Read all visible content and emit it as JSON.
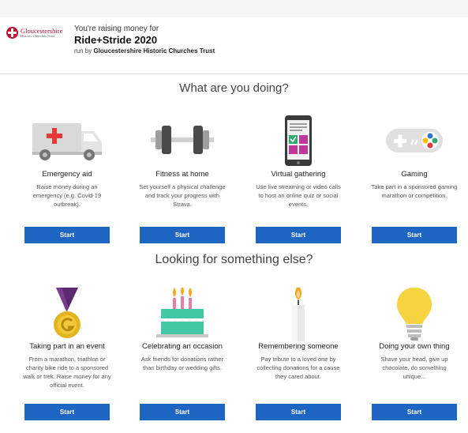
{
  "header": {
    "logo_line1": "Gloucestershire",
    "logo_line2": "Historic Churches Trust",
    "raising_text": "You're raising money for",
    "campaign_name": "Ride+Stride 2020",
    "run_by_prefix": "run by",
    "charity_name": "Gloucestershire Historic Churches Trust"
  },
  "section1": {
    "title": "What are you doing?",
    "cards": [
      {
        "icon": "ambulance-icon",
        "title": "Emergency aid",
        "description": "Raise money during an emergency (e.g. Covid-19 outbreak).",
        "button": "Start"
      },
      {
        "icon": "dumbbell-icon",
        "title": "Fitness at home",
        "description": "Set yourself a physical challenge and track your progress with Strava.",
        "button": "Start"
      },
      {
        "icon": "smartphone-icon",
        "title": "Virtual gathering",
        "description": "Use live streaming or video calls to host an online quiz or social events.",
        "button": "Start"
      },
      {
        "icon": "gamepad-icon",
        "title": "Gaming",
        "description": "Take part in a sponsored gaming marathon or competition.",
        "button": "Start"
      }
    ]
  },
  "section2": {
    "title": "Looking for something else?",
    "cards": [
      {
        "icon": "medal-icon",
        "title": "Taking part in an event",
        "description": "From a marathon, triathlon or charity bike ride to a sponsored walk or trek. Raise money for any official event.",
        "button": "Start"
      },
      {
        "icon": "cake-icon",
        "title": "Celebrating an occasion",
        "description": "Ask friends for donations rather than birthday or wedding gifts.",
        "button": "Start"
      },
      {
        "icon": "candle-icon",
        "title": "Remembering someone",
        "description": "Pay tribute to a loved one by collecting donations for a cause they cared about.",
        "button": "Start"
      },
      {
        "icon": "lightbulb-icon",
        "title": "Doing your own thing",
        "description": "Shave your head, give up chocolate, do something unique...",
        "button": "Start"
      }
    ]
  },
  "colors": {
    "button_blue": "#1e66c2",
    "ambulance_red": "#e53935",
    "medal_purple": "#5b2a6e",
    "medal_gold": "#e3b420",
    "flame_orange": "#f5a623",
    "cake_green": "#43c7a5",
    "bulb_yellow": "#f5d341"
  }
}
